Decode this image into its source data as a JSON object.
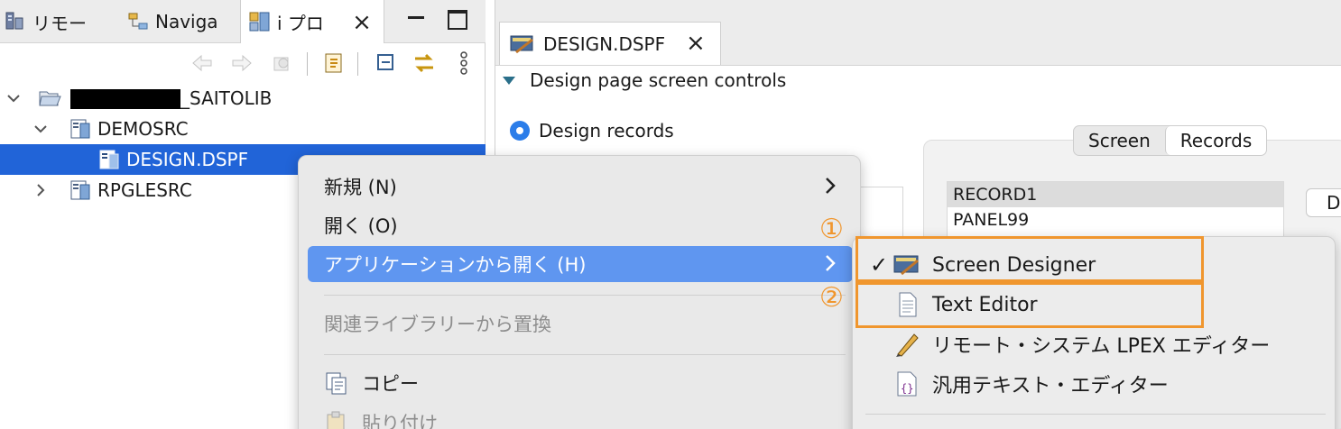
{
  "left_view": {
    "tabs": [
      {
        "label": "リモー",
        "icon": "remote-systems-icon"
      },
      {
        "label": "Naviga",
        "icon": "navigator-icon"
      },
      {
        "label": "i プロ",
        "icon": "iprojects-icon",
        "active": true
      }
    ],
    "tree": [
      {
        "label": "_SAITOLIB",
        "level": 0,
        "expanded": true,
        "redacted_prefix": true
      },
      {
        "label": "DEMOSRC",
        "level": 1,
        "expanded": true
      },
      {
        "label": "DESIGN.DSPF",
        "level": 2,
        "selected": true
      },
      {
        "label": "RPGLESRC",
        "level": 1,
        "expanded": false
      }
    ]
  },
  "editor": {
    "tab_label": "DESIGN.DSPF",
    "section_title": "Design page screen controls",
    "radio_design_records": "Design records",
    "segments": [
      "Screen",
      "Records"
    ],
    "active_segment": "Records",
    "records": [
      "RECORD1",
      "PANEL99"
    ],
    "side_button_label": "De"
  },
  "context_menu": {
    "items": [
      {
        "label": "新規 (N)",
        "submenu": true
      },
      {
        "label": "開く (O)"
      },
      {
        "label": "アプリケーションから開く (H)",
        "submenu": true,
        "highlighted": true
      },
      {
        "label": "関連ライブラリーから置換",
        "disabled": true
      },
      {
        "label": "コピー",
        "icon": "copy-icon"
      },
      {
        "label": "貼り付け",
        "icon": "paste-icon",
        "disabled": true
      }
    ]
  },
  "submenu": {
    "items": [
      {
        "label": "Screen Designer",
        "checked": true,
        "icon": "screen-designer-icon"
      },
      {
        "label": "Text Editor",
        "icon": "text-file-icon"
      },
      {
        "label": "リモート・システム LPEX エディター",
        "icon": "pencil-icon"
      },
      {
        "label": "汎用テキスト・エディター",
        "icon": "generic-text-editor-icon"
      }
    ]
  },
  "annotations": {
    "marker_1": "①",
    "marker_2": "②",
    "color": "#f0962e"
  },
  "colors": {
    "selection": "#2164d8",
    "menu_highlight": "#5f96f0",
    "radio_accent": "#2b7de9"
  }
}
